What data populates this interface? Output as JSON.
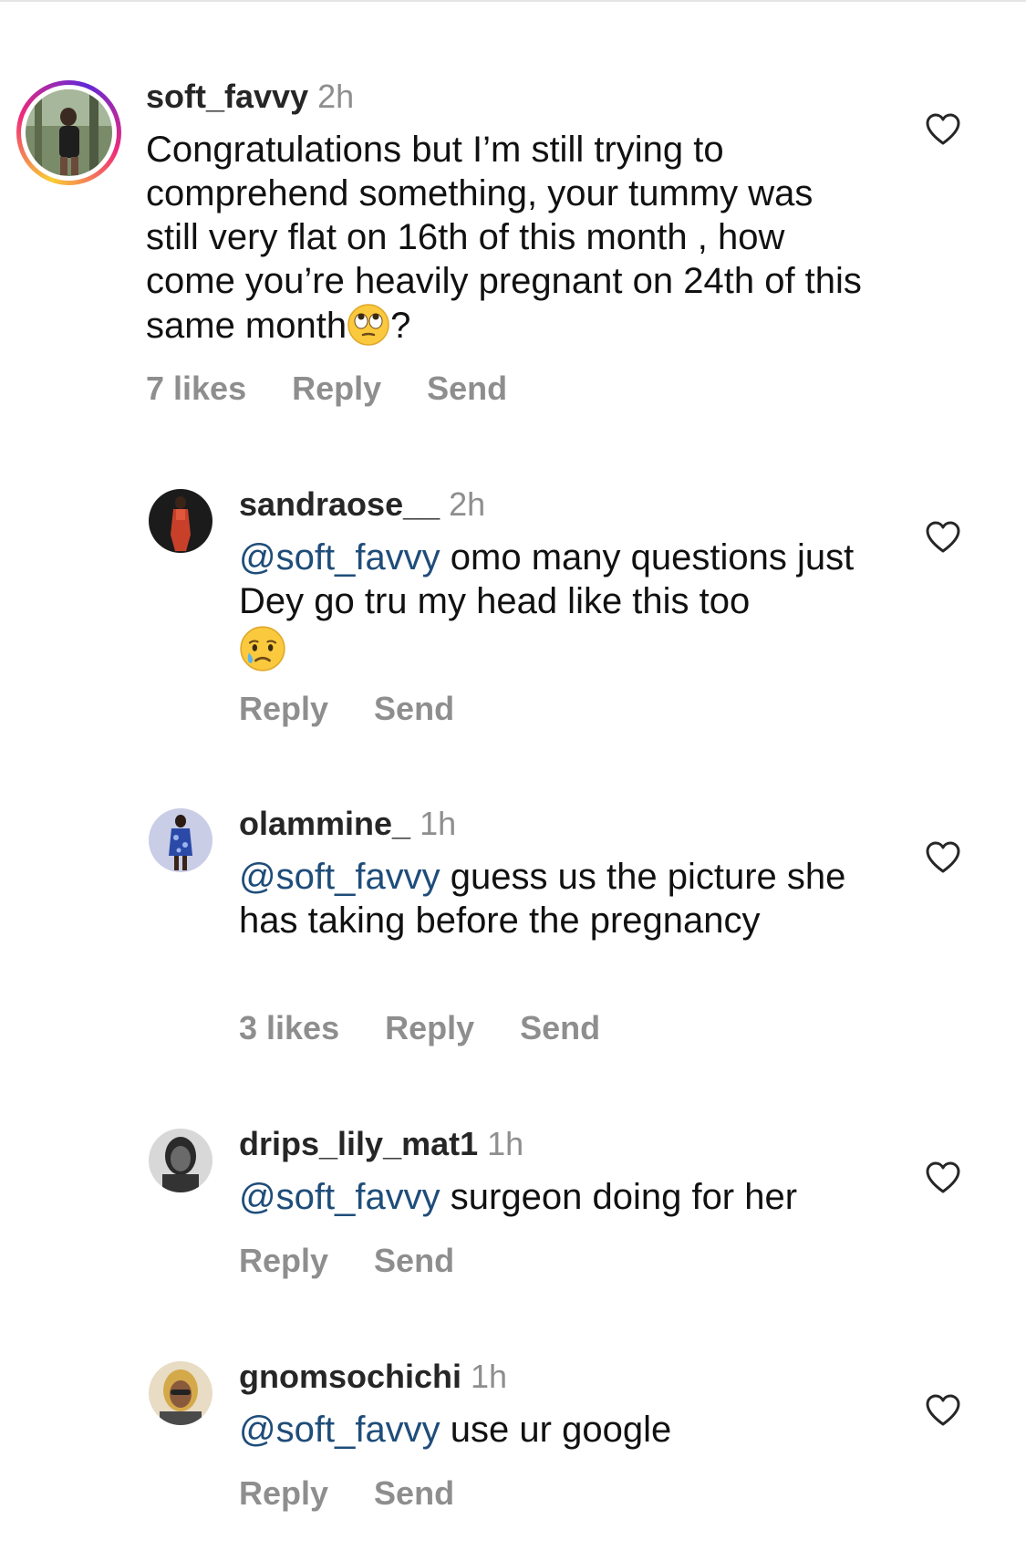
{
  "comments": [
    {
      "username": "soft_favvy",
      "time": "2h",
      "text_parts": [
        "Congratulations but I’m still trying to comprehend something, your tummy was still very flat on 16th of this month , how come you’re heavily pregnant on 24th of this same month",
        "?"
      ],
      "emoji": "face-with-rolling-eyes",
      "likes": "7 likes",
      "reply_label": "Reply",
      "send_label": "Send",
      "has_story": true
    },
    {
      "username": "sandraose__",
      "time": "2h",
      "mention": "@soft_favvy",
      "text": " omo many questions just Dey go tru my head like this too",
      "emoji": "crying-face",
      "reply_label": "Reply",
      "send_label": "Send"
    },
    {
      "username": "olammine_",
      "time": "1h",
      "mention": "@soft_favvy",
      "text": " guess us the picture she has taking before the pregnancy",
      "likes": "3 likes",
      "reply_label": "Reply",
      "send_label": "Send"
    },
    {
      "username": "drips_lily_mat1",
      "time": "1h",
      "mention": "@soft_favvy",
      "text": " surgeon doing for her",
      "reply_label": "Reply",
      "send_label": "Send"
    },
    {
      "username": "gnomsochichi",
      "time": "1h",
      "mention": "@soft_favvy",
      "text": " use ur google",
      "reply_label": "Reply",
      "send_label": "Send"
    }
  ],
  "icons": {
    "like": "heart-outline-icon"
  },
  "colors": {
    "mention": "#1f4d7a",
    "secondary_text": "#8e8e8e",
    "primary_text": "#111111"
  }
}
